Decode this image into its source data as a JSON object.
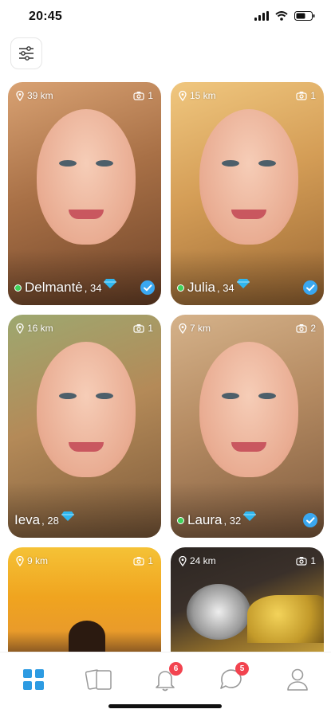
{
  "status_bar": {
    "time": "20:45"
  },
  "colors": {
    "accent": "#2d9be2",
    "online": "#3fd25a",
    "badge": "#f2434f",
    "verified": "#3aa7f0"
  },
  "toolbar": {
    "filter_icon": "sliders-icon"
  },
  "profiles": [
    {
      "distance": "39 km",
      "photos": "1",
      "name": "Delmantė",
      "age": ", 34",
      "online": true,
      "premium": true,
      "verified": true
    },
    {
      "distance": "15 km",
      "photos": "1",
      "name": "Julia",
      "age": ", 34",
      "online": true,
      "premium": true,
      "verified": true
    },
    {
      "distance": "16 km",
      "photos": "1",
      "name": "Ieva",
      "age": ", 28",
      "online": false,
      "premium": true,
      "verified": false
    },
    {
      "distance": "7 km",
      "photos": "2",
      "name": "Laura",
      "age": ", 32",
      "online": true,
      "premium": true,
      "verified": true
    },
    {
      "distance": "9 km",
      "photos": "1"
    },
    {
      "distance": "24 km",
      "photos": "1"
    }
  ],
  "nav": {
    "items": [
      {
        "icon": "grid-icon",
        "active": true
      },
      {
        "icon": "cards-icon",
        "active": false
      },
      {
        "icon": "bell-icon",
        "badge": "6"
      },
      {
        "icon": "chat-icon",
        "badge": "5"
      },
      {
        "icon": "profile-icon",
        "active": false
      }
    ]
  }
}
